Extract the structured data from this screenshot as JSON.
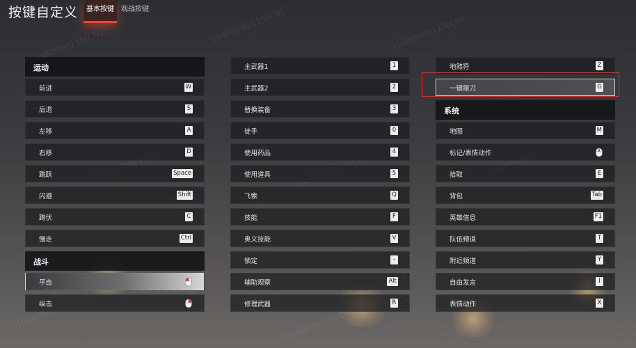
{
  "header": {
    "title": "按键自定义",
    "tabs": [
      {
        "label": "基本按键",
        "active": true
      },
      {
        "label": "观战按键",
        "active": false
      }
    ]
  },
  "watermark_text": "10460000115[CN]",
  "colors": {
    "accent": "#e24a3a",
    "highlight_box": "#e03030",
    "key_bg": "#ececec"
  },
  "columns": {
    "left": {
      "sections": [
        {
          "title": "运动",
          "items": [
            {
              "label": "前进",
              "key": "W"
            },
            {
              "label": "后退",
              "key": "S"
            },
            {
              "label": "左移",
              "key": "A"
            },
            {
              "label": "右移",
              "key": "D"
            },
            {
              "label": "跳跃",
              "key": "Space"
            },
            {
              "label": "闪避",
              "key": "Shift"
            },
            {
              "label": "蹲伏",
              "key": "C"
            },
            {
              "label": "慢走",
              "key": "Ctrl"
            }
          ]
        },
        {
          "title": "战斗",
          "items": [
            {
              "label": "平击",
              "key_icon": "mouse-left-icon",
              "selected": true
            },
            {
              "label": "纵击",
              "key_icon": "mouse-right-icon"
            }
          ]
        }
      ]
    },
    "middle": {
      "items": [
        {
          "label": "主武器1",
          "key": "1"
        },
        {
          "label": "主武器2",
          "key": "2"
        },
        {
          "label": "替换装备",
          "key": "3"
        },
        {
          "label": "徒手",
          "key": "0"
        },
        {
          "label": "使用药品",
          "key": "4"
        },
        {
          "label": "使用道具",
          "key": "5"
        },
        {
          "label": "飞索",
          "key": "Q"
        },
        {
          "label": "技能",
          "key": "F"
        },
        {
          "label": "奥义技能",
          "key": "V"
        },
        {
          "label": "锁定",
          "key": "-"
        },
        {
          "label": "辅助观察",
          "key": "Alt"
        },
        {
          "label": "修理武器",
          "key": "R"
        }
      ]
    },
    "right": {
      "top_items": [
        {
          "label": "地煞符",
          "key": "Z"
        },
        {
          "label": "一键振刀",
          "key": "G",
          "boxed": true
        }
      ],
      "sections": [
        {
          "title": "系统",
          "items": [
            {
              "label": "地图",
              "key": "M"
            },
            {
              "label": "标记/表情动作",
              "key_icon": "mouse-middle-icon"
            },
            {
              "label": "拾取",
              "key": "E"
            },
            {
              "label": "背包",
              "key": "Tab"
            },
            {
              "label": "英雄信息",
              "key": "F1"
            },
            {
              "label": "队伍频道",
              "key": "T"
            },
            {
              "label": "附近频道",
              "key": "Y"
            },
            {
              "label": "自由发言",
              "key": "I"
            },
            {
              "label": "表情动作",
              "key": "X"
            }
          ]
        }
      ]
    }
  }
}
